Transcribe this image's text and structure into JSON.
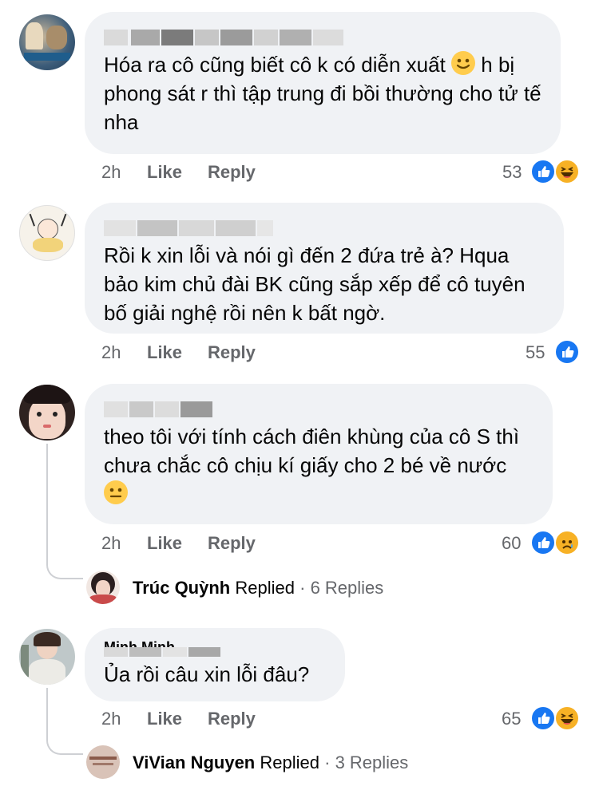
{
  "comments": [
    {
      "text": "Hóa ra cô cũng biết cô k có diễn xuất",
      "text_tail": " h bị phong sát r thì tập trung đi bồi thường cho tử tế nha",
      "time": "2h",
      "like": "Like",
      "reply": "Reply",
      "count": "53",
      "reactions": [
        "like",
        "haha"
      ]
    },
    {
      "text": "Rồi k xin lỗi và nói gì đến 2 đứa trẻ à? Hqua bảo kim chủ đài BK cũng sắp xếp để cô tuyên bố giải nghệ rồi nên k bất ngờ.",
      "time": "2h",
      "like": "Like",
      "reply": "Reply",
      "count": "55",
      "reactions": [
        "like"
      ]
    },
    {
      "text": "theo tôi với tính cách điên khùng của cô S thì chưa chắc cô chịu kí giấy cho 2 bé về nước",
      "time": "2h",
      "like": "Like",
      "reply": "Reply",
      "count": "60",
      "reactions": [
        "like",
        "sad"
      ],
      "replied": {
        "name": "Trúc Quỳnh",
        "label": "Replied",
        "dot": "·",
        "count": "6 Replies"
      }
    },
    {
      "name_partial": "Minh Minh",
      "text": "Ủa rồi câu xin lỗi đâu?",
      "time": "2h",
      "like": "Like",
      "reply": "Reply",
      "count": "65",
      "reactions": [
        "like",
        "haha"
      ],
      "replied": {
        "name": "ViVian Nguyen",
        "label": "Replied",
        "dot": "·",
        "count": "3 Replies"
      }
    }
  ],
  "icons": {
    "like": "like-reaction-icon",
    "haha": "haha-reaction-icon",
    "sad": "sad-reaction-icon",
    "smile": "slightly-smiling-emoji",
    "neutral": "neutral-face-emoji"
  },
  "colors": {
    "bubble": "#f0f2f5",
    "meta_text": "#65676b",
    "like_blue": "#1877f2",
    "reaction_yellow": "#f7b125"
  }
}
